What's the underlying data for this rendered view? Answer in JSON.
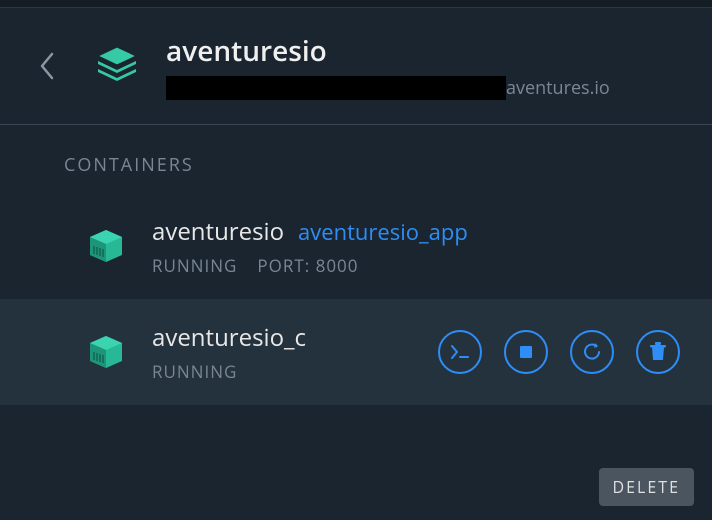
{
  "header": {
    "title": "aventuresio",
    "domain": "aventures.io"
  },
  "section_label": "CONTAINERS",
  "containers": [
    {
      "name": "aventuresio",
      "link": "aventuresio_app",
      "status": "RUNNING",
      "port_label": "PORT: 8000"
    },
    {
      "name": "aventuresio_c",
      "link": "",
      "status": "RUNNING",
      "port_label": ""
    }
  ],
  "delete_label": "DELETE"
}
